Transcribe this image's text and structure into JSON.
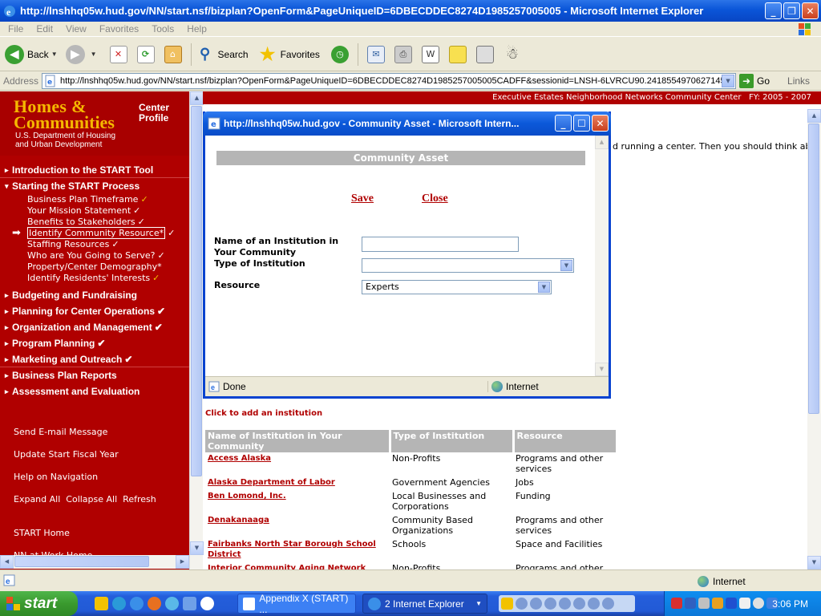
{
  "window": {
    "title": "http://lnshhq05w.hud.gov/NN/start.nsf/bizplan?OpenForm&PageUniqueID=6DBECDDEC8274D1985257005005 - Microsoft Internet Explorer"
  },
  "menu": [
    "File",
    "Edit",
    "View",
    "Favorites",
    "Tools",
    "Help"
  ],
  "toolbar": {
    "back": "Back",
    "search": "Search",
    "favorites": "Favorites"
  },
  "address": {
    "label": "Address",
    "url": "http://lnshhq05w.hud.gov/NN/start.nsf/bizplan?OpenForm&PageUniqueID=6DBECDDEC8274D1985257005005CADFF&sessionid=LNSH-6LVRCU90.241855497062714545&",
    "go": "Go",
    "links": "Links"
  },
  "logo": {
    "line1": "Homes &",
    "line2": "Communities",
    "dept1": "U.S. Department of Housing",
    "dept2": "and Urban Development",
    "profile1": "Center",
    "profile2": "Profile"
  },
  "nav": {
    "intro": "Introduction to the START Tool",
    "starting": "Starting the START Process",
    "subs": [
      "Business Plan Timeframe",
      "Your Mission Statement",
      "Benefits to Stakeholders",
      "Identify Community Resource*",
      "Staffing Resources",
      "Who are You Going to Serve?",
      "Property/Center Demography*",
      "Identify Residents' Interests"
    ],
    "sections": [
      "Budgeting and Fundraising",
      "Planning for Center Operations",
      "Organization and Management",
      "Program Planning",
      "Marketing and Outreach",
      "Business Plan Reports",
      "Assessment and Evaluation"
    ],
    "bottom": {
      "email": "Send E-mail Message",
      "fiscal": "Update Start Fiscal Year",
      "help": "Help on Navigation",
      "expand": "Expand All",
      "collapse": "Collapse All",
      "refresh": "Refresh",
      "home": "START Home",
      "nnwork": "NN at Work Home"
    }
  },
  "header": {
    "center": "Executive Estates Neighborhood Networks Community Center",
    "fy": "FY: 2005 - 2007"
  },
  "main": {
    "text1": "d running a center. Then you should think about",
    "add_link": "Click to add an institution",
    "table": {
      "headers": [
        "Name of Institution in Your Community",
        "Type of Institution",
        "Resource"
      ],
      "rows": [
        {
          "name": "Access Alaska",
          "type": "Non-Profits",
          "resource": "Programs and other services"
        },
        {
          "name": "Alaska Department of Labor",
          "type": "Government Agencies",
          "resource": "Jobs"
        },
        {
          "name": "Ben Lomond, Inc.",
          "type": "Local Businesses and Corporations",
          "resource": "Funding"
        },
        {
          "name": "Denakanaaga",
          "type": "Community Based Organizations",
          "resource": "Programs and other services"
        },
        {
          "name": "Fairbanks North Star Borough School District",
          "type": "Schools",
          "resource": "Space and Facilities"
        },
        {
          "name": "Interior Community Aging Network",
          "type": "Non-Profits",
          "resource": "Programs and other"
        }
      ]
    }
  },
  "popup": {
    "title": "http://lnshhq05w.hud.gov - Community Asset - Microsoft Intern...",
    "heading": "Community Asset",
    "save": "Save",
    "close": "Close",
    "name_label": "Name of an Institution in Your Community",
    "name_value": "",
    "type_label": "Type of Institution",
    "type_value": "",
    "resource_label": "Resource",
    "resource_value": "Experts",
    "status": "Done",
    "zone": "Internet"
  },
  "status": {
    "zone": "Internet"
  },
  "taskbar": {
    "start": "start",
    "task1": "Appendix X (START) ...",
    "task2": "2 Internet Explorer",
    "clock": "3:06 PM"
  }
}
